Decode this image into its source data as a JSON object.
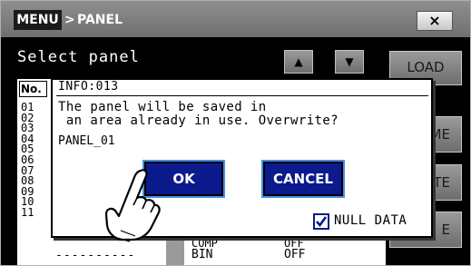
{
  "titlebar": {
    "menu_label": "MENU",
    "separator": ">",
    "crumb": "PANEL",
    "close_label": "×"
  },
  "panel": {
    "select_label": "Select panel",
    "up_icon": "triangle-up-icon",
    "down_icon": "triangle-down-icon",
    "load_label": "LOAD",
    "side_button_2_partial": "ME",
    "side_button_3_partial": "TE",
    "side_button_4_partial": "E",
    "column_no": "No.",
    "row_numbers": [
      "01",
      "02",
      "03",
      "04",
      "05",
      "06",
      "07",
      "08",
      "09",
      "10",
      "11"
    ],
    "last_row_name": "----------",
    "comp_label": "COMP",
    "comp_value": "OFF",
    "bin_label": "BIN",
    "bin_value": "OFF"
  },
  "dialog": {
    "id": "INFO:013",
    "message_line1": "The panel will be saved in",
    "message_line2": " an area already in use. Overwrite?",
    "panel_name": "PANEL_01",
    "ok_label": "OK",
    "cancel_label": "CANCEL",
    "null_data_label": "NULL DATA",
    "null_data_checked": true
  },
  "colors": {
    "screen_bg": "#000000",
    "titlebar": "#7f7f7f",
    "dialog_button": "#0b1a8c",
    "dialog_button_border": "#4b8fe0"
  }
}
